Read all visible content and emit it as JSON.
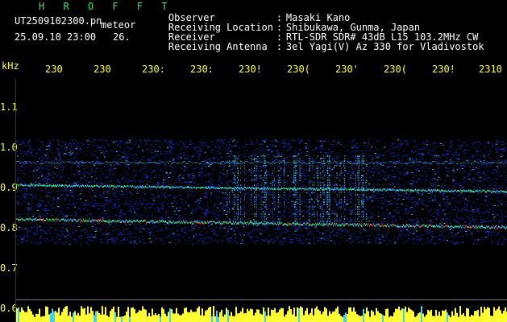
{
  "header": {
    "title": "H R O F F T",
    "filename": "UT2509102300.pn",
    "meteor_label": "meteor",
    "datetime": "25.09.10 23:00",
    "count": "26.",
    "info": [
      {
        "label": "Observer",
        "value": "Masaki Kano"
      },
      {
        "label": "Receiving Location",
        "value": "Shibukawa, Gunma, Japan"
      },
      {
        "label": "Receiver",
        "value": "RTL-SDR SDR# 43dB L15 103.2MHz CW"
      },
      {
        "label": "Receiving Antenna",
        "value": "3el Yagi(V) Az 330 for Vladivostok"
      }
    ]
  },
  "axis": {
    "unit": "kHz",
    "freq_labels": [
      "1.1",
      "1.0",
      "0.9",
      "0.8",
      "0.7",
      "0.6"
    ],
    "time_labels": [
      "230",
      "230",
      "230:",
      "230:",
      "230!",
      "230(",
      "230'",
      "230(",
      "230!",
      "2310"
    ]
  },
  "colors": {
    "background": "#000000",
    "label_white": "#ffffff",
    "title_green": "#2fe66a",
    "axis_yellow": "#ffff33",
    "signal_blue": "#1e3cff",
    "signal_cyan": "#3fd0ff",
    "signal_green": "#3cff7a",
    "signal_red": "#ff4030"
  }
}
